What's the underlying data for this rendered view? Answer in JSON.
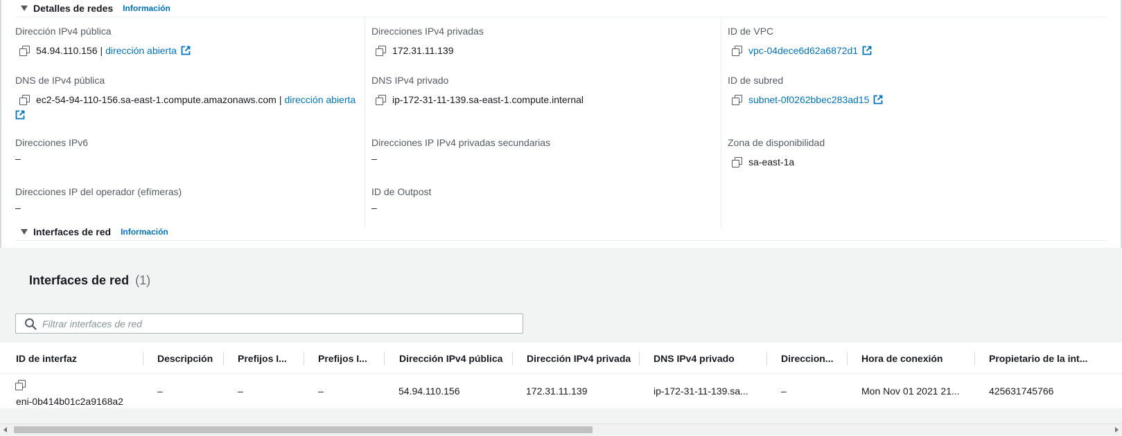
{
  "network_details": {
    "title": "Detalles de redes",
    "info": "Información",
    "public_ipv4_label": "Dirección IPv4 pública",
    "public_ipv4_value": "54.94.110.156",
    "public_ipv4_sep": "|",
    "public_ipv4_link": "dirección abierta",
    "public_dns_label": "DNS de IPv4 pública",
    "public_dns_value": "ec2-54-94-110-156.sa-east-1.compute.amazonaws.com",
    "public_dns_sep": "|",
    "public_dns_link": "dirección abierta",
    "ipv6_label": "Direcciones IPv6",
    "ipv6_value": "–",
    "carrier_ip_label": "Direcciones IP del operador (efímeras)",
    "carrier_ip_value": "–",
    "private_ipv4_label": "Direcciones IPv4 privadas",
    "private_ipv4_value": "172.31.11.139",
    "private_dns_label": "DNS IPv4 privado",
    "private_dns_value": "ip-172-31-11-139.sa-east-1.compute.internal",
    "secondary_ip_label": "Direcciones IP IPv4 privadas secundarias",
    "secondary_ip_value": "–",
    "outpost_label": "ID de Outpost",
    "outpost_value": "–",
    "vpc_label": "ID de VPC",
    "vpc_value": "vpc-04dece6d62a6872d1",
    "subnet_label": "ID de subred",
    "subnet_value": "subnet-0f0262bbec283ad15",
    "az_label": "Zona de disponibilidad",
    "az_value": "sa-east-1a"
  },
  "network_interfaces_section": {
    "title": "Interfaces de red",
    "info": "Información"
  },
  "interfaces_panel": {
    "title": "Interfaces de red",
    "count": "(1)",
    "filter_placeholder": "Filtrar interfaces de red"
  },
  "table": {
    "headers": [
      "ID de interfaz",
      "Descripción",
      "Prefijos I...",
      "Prefijos I...",
      "Dirección IPv4 pública",
      "Dirección IPv4 privada",
      "DNS IPv4 privado",
      "Direccion...",
      "Hora de conexión",
      "Propietario de la int..."
    ],
    "rows": [
      {
        "interface_id": "eni-0b414b01c2a9168a2",
        "description": "–",
        "prefix_1": "–",
        "prefix_2": "–",
        "public_ipv4": "54.94.110.156",
        "private_ipv4": "172.31.11.139",
        "private_dns": "ip-172-31-11-139.sa...",
        "addresses": "–",
        "attach_time": "Mon Nov 01 2021 21...",
        "owner": "425631745766"
      }
    ]
  },
  "colors": {
    "link": "#0073bb",
    "label": "#545b64",
    "panel_bg": "#f2f3f3"
  }
}
